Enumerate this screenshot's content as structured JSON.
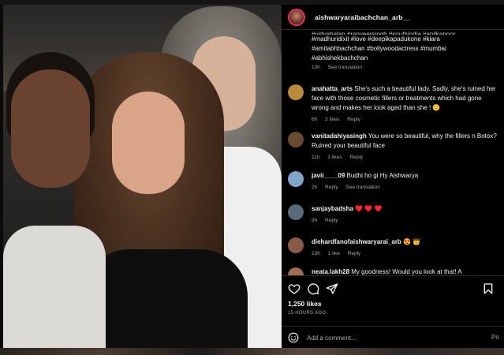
{
  "post": {
    "username": "aishwaryaraibachchan_arb__",
    "caption_tail_clipped": "#vidyabalan #ranveersingh #southindia #anilkapoor",
    "caption_lines": [
      "#madhuridixit #love #deepikapadukone #kiara",
      "#amitabhbachchan #bollywoodactress #mumbai",
      "#abhishekbachchan"
    ],
    "caption_time": "13h",
    "caption_translate": "See translation"
  },
  "comments": [
    {
      "user": "anahatta_arts",
      "text": "She's such a beautiful lady. Sadly, she's ruined her face with those cosmetic fillers or treatments which had gone wrong and makes her look aged than she ! 😕",
      "time": "6h",
      "likes": "3 likes",
      "reply": "Reply",
      "avatar_color": "#b88a3a"
    },
    {
      "user": "vanitadahiyasingh",
      "text": "You were so beautiful, why the fillers n Botox? Ruined your beautiful face",
      "time": "11h",
      "likes": "3 likes",
      "reply": "Reply",
      "avatar_color": "#6b4a32"
    },
    {
      "user": "javii____09",
      "text": "Budhi ho gi Hy Aishwarya",
      "time": "2h",
      "reply": "Reply",
      "translate": "See translation",
      "avatar_color": "#7fa6c8"
    },
    {
      "user": "sanjaybadsha",
      "text": "♥️ ♥️ ♥️",
      "time": "9h",
      "reply": "Reply",
      "avatar_color": "#5a6a78"
    },
    {
      "user": "diehardfanofaishwaryarai_arb",
      "text": "😍 👑",
      "time": "13h",
      "likes": "1 like",
      "reply": "Reply",
      "avatar_color": "#8a5a48"
    },
    {
      "user": "neata.lakh28",
      "text": "My goodness! Would you look at that! A",
      "avatar_color": "#a06b50"
    }
  ],
  "actions": {
    "like_icon": "heart-icon",
    "comment_icon": "comment-icon",
    "share_icon": "share-icon",
    "save_icon": "bookmark-icon"
  },
  "likes": "1,250 likes",
  "ago": "15 HOURS AGO",
  "add_comment": {
    "placeholder": "Add a comment...",
    "post_label": "Po"
  }
}
